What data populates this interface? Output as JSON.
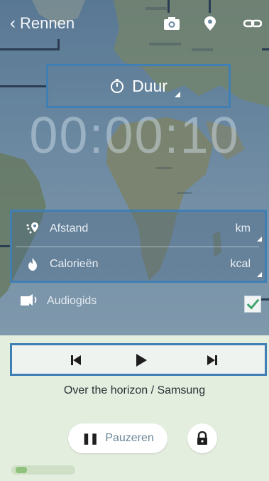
{
  "header": {
    "back_label": "Rennen"
  },
  "icons": {
    "camera": "camera-icon",
    "location": "location-pin-icon",
    "link": "link-icon",
    "timer": "stopwatch-icon",
    "distance": "distance-icon",
    "calories": "flame-icon",
    "audio": "audio-guide-icon",
    "lock": "lock-icon"
  },
  "goal": {
    "type_label": "Duur"
  },
  "timer": {
    "value": "00:00:10"
  },
  "stats": [
    {
      "label": "Afstand",
      "unit": "km"
    },
    {
      "label": "Calorieën",
      "unit": "kcal"
    }
  ],
  "audio_guide": {
    "label": "Audiogids",
    "checked": true
  },
  "player": {
    "track": "Over the horizon / Samsung"
  },
  "actions": {
    "pause_label": "Pauzeren"
  },
  "colors": {
    "highlight": "#3f7fb4",
    "checkbox_check": "#3ea36c"
  }
}
